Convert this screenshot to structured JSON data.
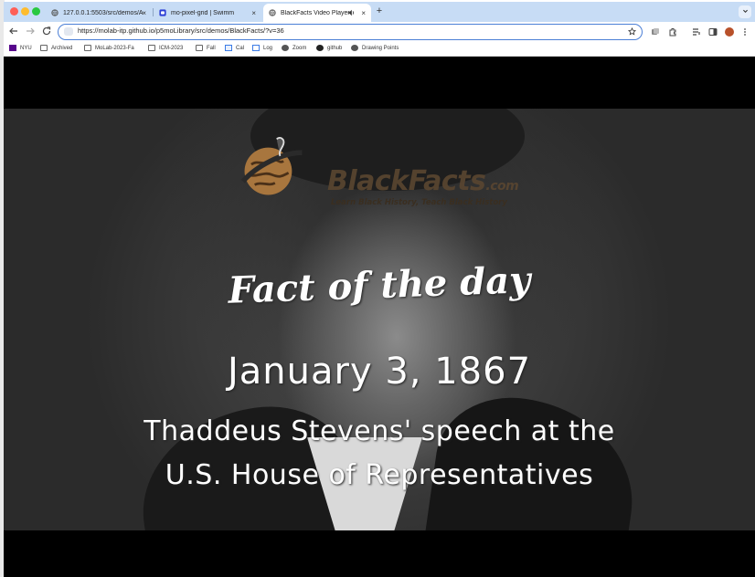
{
  "tabs": [
    {
      "title": "127.0.0.1:5503/src/demos/A",
      "close": "×"
    },
    {
      "title": "mo-pixel-grid | Swimm",
      "close": "×"
    },
    {
      "title": "BlackFacts Video Player",
      "close": "×",
      "active": true
    }
  ],
  "toolbar": {
    "url": "https://molab-itp.github.io/p5moLibrary/src/demos/BlackFacts/?v=36",
    "new_tab": "+"
  },
  "bookmarks": [
    {
      "label": "NYU",
      "icon": "nyu-icon"
    },
    {
      "label": "Archived",
      "icon": "folder-icon"
    },
    {
      "label": "MoLab-2023-Fa",
      "icon": "folder-icon"
    },
    {
      "label": "ICM-2023",
      "icon": "folder-icon"
    },
    {
      "label": "Fall",
      "icon": "folder-icon"
    },
    {
      "label": "Cal",
      "icon": "calendar-icon"
    },
    {
      "label": "Log",
      "icon": "doc-icon"
    },
    {
      "label": "Zoom",
      "icon": "globe-icon"
    },
    {
      "label": "github",
      "icon": "github-icon"
    },
    {
      "label": "Drawing Points",
      "icon": "globe-icon"
    }
  ],
  "video": {
    "brand": "BlackFacts",
    "brand_suffix": ".com",
    "tagline": "Learn Black History, Teach Black History",
    "heading": "Fact of the day",
    "date": "January 3, 1867",
    "line1": "Thaddeus Stevens' speech at the",
    "line2": "U.S. House of Representatives"
  },
  "colors": {
    "tabstrip": "#c7dcf5",
    "omnibox_border": "#4b7fd6",
    "logo_brown": "#5a4630",
    "monument_orange": "#e88a2a"
  }
}
